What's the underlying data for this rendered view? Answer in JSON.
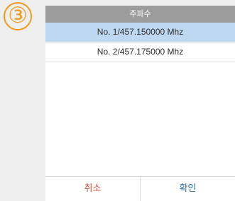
{
  "step_badge": "③",
  "dialog": {
    "title": "주파수",
    "options": [
      {
        "label": "No. 1/457.150000 Mhz",
        "selected": true
      },
      {
        "label": "No. 2/457.175000 Mhz",
        "selected": false
      }
    ],
    "cancel_label": "취소",
    "confirm_label": "확인"
  },
  "colors": {
    "badge": "#f29a1c",
    "title_bar": "#9c9c9c",
    "selected_row": "#bdd8f0",
    "cancel_text": "#d35340",
    "confirm_text": "#2f6fa8"
  }
}
